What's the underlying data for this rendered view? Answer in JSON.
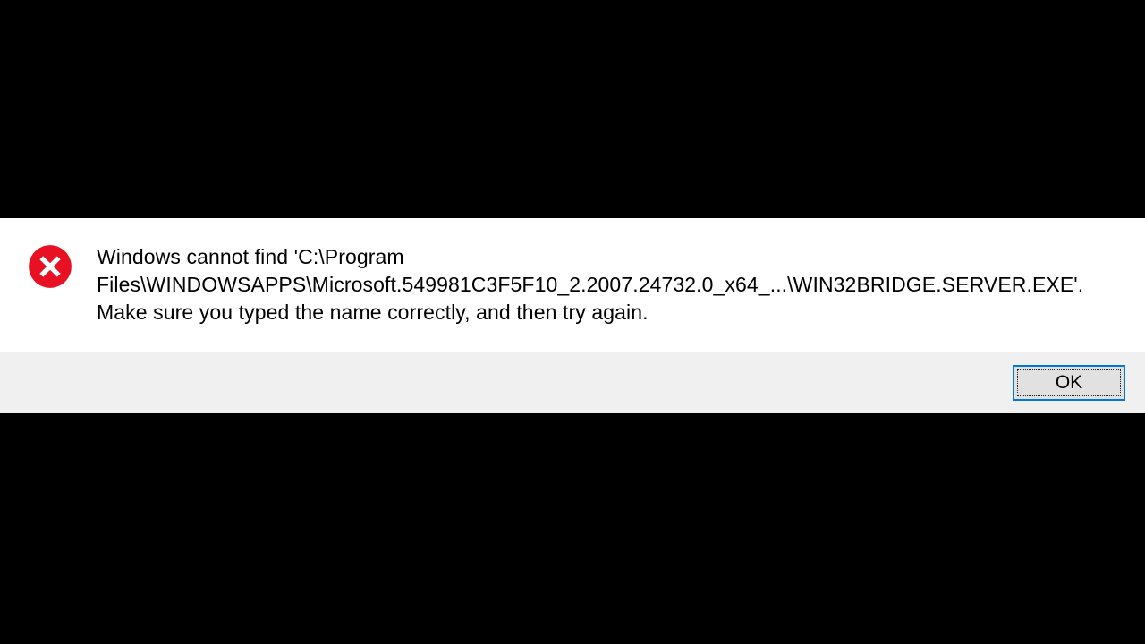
{
  "dialog": {
    "message": "Windows cannot find 'C:\\Program Files\\WINDOWSAPPS\\Microsoft.549981C3F5F10_2.2007.24732.0_x64_...\\WIN32BRIDGE.SERVER.EXE'. Make sure you typed the name correctly, and then try again.",
    "ok_label": "OK",
    "icon": "error-icon"
  }
}
